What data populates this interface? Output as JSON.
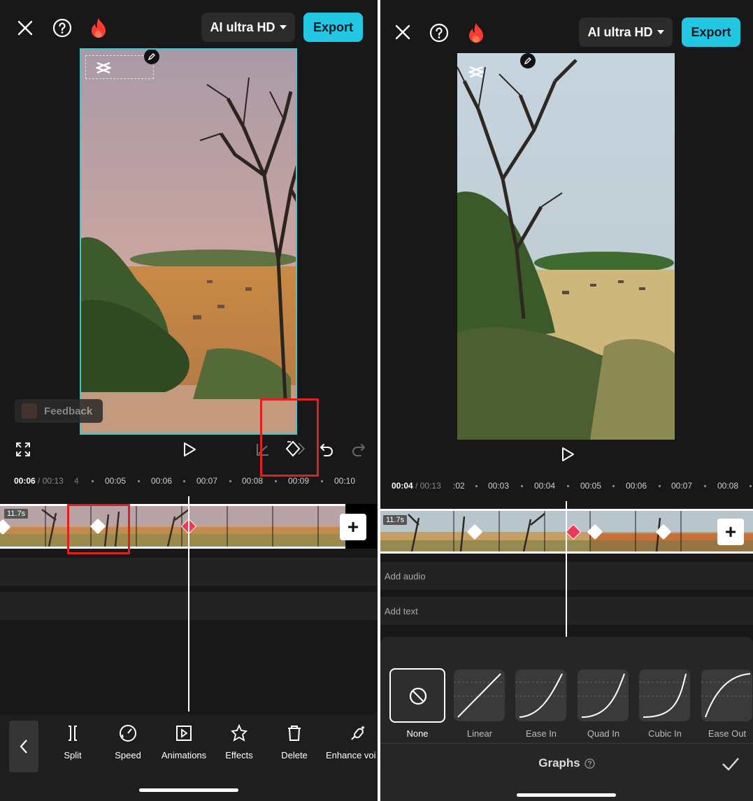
{
  "left": {
    "header": {
      "quality_label": "AI ultra HD",
      "export_label": "Export"
    },
    "feedback_label": "Feedback",
    "timeline": {
      "current_time": "00:06",
      "total_time": "00:13",
      "ticks": [
        "00:05",
        "00:06",
        "00:07",
        "00:08",
        "00:09",
        "00:10"
      ],
      "clip_duration": "11.7s"
    },
    "toolbar": {
      "items": [
        {
          "label": "Split"
        },
        {
          "label": "Speed"
        },
        {
          "label": "Animations"
        },
        {
          "label": "Effects"
        },
        {
          "label": "Delete"
        },
        {
          "label": "Enhance voi"
        }
      ]
    }
  },
  "right": {
    "header": {
      "quality_label": "AI ultra HD",
      "export_label": "Export"
    },
    "timeline": {
      "current_time": "00:04",
      "total_time": "00:13",
      "ticks": [
        "00:03",
        "00:04",
        "00:05",
        "00:06",
        "00:07",
        "00:08"
      ],
      "partial_tick": ":02",
      "clip_duration": "11.7s",
      "add_audio": "Add audio",
      "add_text": "Add text"
    },
    "graphs": {
      "title": "Graphs",
      "options": [
        "None",
        "Linear",
        "Ease In",
        "Quad In",
        "Cubic In",
        "Ease Out"
      ],
      "selected": "None"
    }
  },
  "colors": {
    "accent": "#22c7e3",
    "keyframe_active": "#ec3a5a",
    "annotation_red": "#e02020",
    "flame": "#ff3b30"
  }
}
